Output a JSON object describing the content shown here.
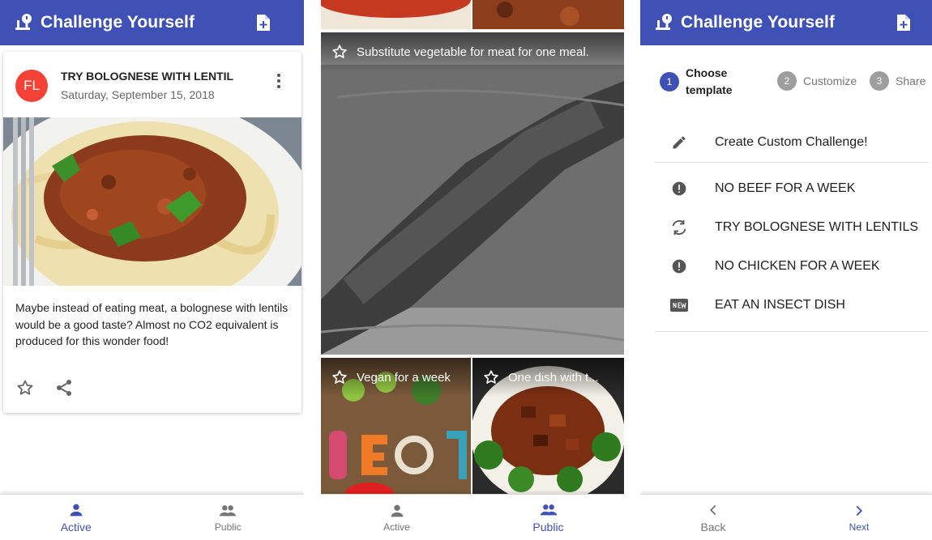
{
  "screen_active": {
    "app_title": "Challenge Yourself",
    "card": {
      "avatar": "FL",
      "title": "TRY BOLOGNESE WITH LENTIL",
      "date": "Saturday, September 15, 2018",
      "body": "Maybe instead of eating meat, a bolognese with lentils would be a good taste? Almost no CO2 equivalent is produced for this wonder food!"
    },
    "nav": [
      {
        "label": "Active",
        "icon": "person-icon"
      },
      {
        "label": "Public",
        "icon": "people-icon"
      }
    ],
    "selected_tab": "Active"
  },
  "screen_public": {
    "tiles": [
      {
        "label": "Substitute vegetable for meat for one meal."
      },
      {
        "label": "Vegan for a week"
      },
      {
        "label": "One dish with t..."
      }
    ],
    "nav": [
      {
        "label": "Active",
        "icon": "person-icon"
      },
      {
        "label": "Public",
        "icon": "people-icon"
      }
    ],
    "selected_tab": "Public"
  },
  "screen_create": {
    "app_title": "Challenge Yourself",
    "steps": [
      {
        "num": "1",
        "label_line1": "Choose",
        "label_line2": "template"
      },
      {
        "num": "2",
        "label": "Customize"
      },
      {
        "num": "3",
        "label": "Share"
      }
    ],
    "custom_item": "Create Custom Challenge!",
    "templates": [
      {
        "label": "NO BEEF FOR A WEEK",
        "icon": "alert-circle-icon"
      },
      {
        "label": "TRY BOLOGNESE WITH LENTILS",
        "icon": "sync-icon"
      },
      {
        "label": "NO CHICKEN FOR A WEEK",
        "icon": "alert-circle-icon"
      },
      {
        "label": "EAT AN INSECT DISH",
        "icon": "new-badge-icon"
      }
    ],
    "back_label": "Back",
    "next_label": "Next"
  },
  "colors": {
    "primary": "#3f51b5",
    "avatar": "#f44336"
  }
}
